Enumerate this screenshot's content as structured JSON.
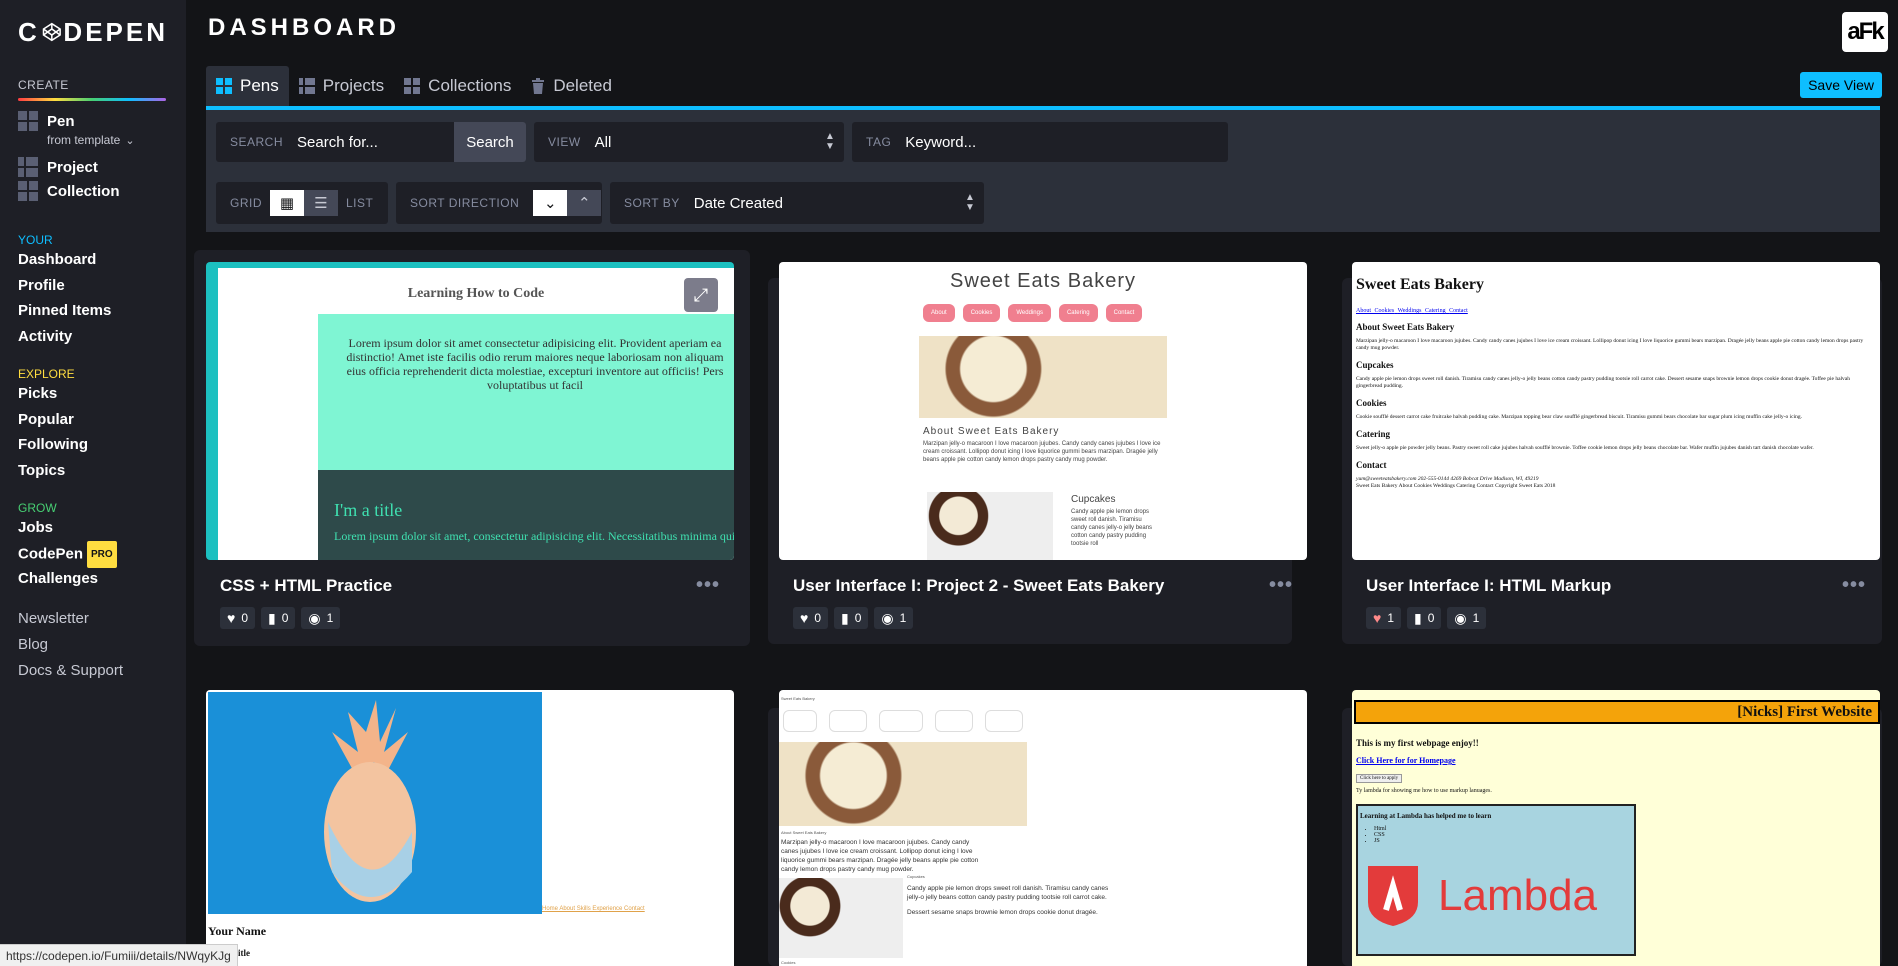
{
  "app": {
    "logo_text_left": "C",
    "logo_text_right": "DEPEN",
    "page_title": "DASHBOARD",
    "avatar": "aFk",
    "accent": "#0ebeff"
  },
  "sidebar": {
    "create_label": "CREATE",
    "create_items": [
      {
        "label": "Pen",
        "sub": "from template"
      },
      {
        "label": "Project"
      },
      {
        "label": "Collection"
      }
    ],
    "groups": [
      {
        "title": "YOUR",
        "color": "#0ebeff",
        "items": [
          "Dashboard",
          "Profile",
          "Pinned Items",
          "Activity"
        ]
      },
      {
        "title": "EXPLORE",
        "color": "#ffdd40",
        "items": [
          "Picks",
          "Popular",
          "Following",
          "Topics"
        ]
      },
      {
        "title": "GROW",
        "color": "#47cf73",
        "items": [
          "Jobs",
          "CodePen",
          "Challenges"
        ],
        "pro_badge": "PRO"
      }
    ],
    "footer_links": [
      "Newsletter",
      "Blog",
      "Docs & Support"
    ]
  },
  "tabs": [
    {
      "label": "Pens",
      "active": true,
      "icon": "grid-icon"
    },
    {
      "label": "Projects",
      "active": false,
      "icon": "project-icon"
    },
    {
      "label": "Collections",
      "active": false,
      "icon": "collection-icon"
    },
    {
      "label": "Deleted",
      "active": false,
      "icon": "trash-icon"
    }
  ],
  "save_view": "Save View",
  "filters": {
    "search_label": "SEARCH",
    "search_placeholder": "Search for...",
    "search_button": "Search",
    "view_label": "VIEW",
    "view_value": "All",
    "tag_label": "TAG",
    "tag_placeholder": "Keyword...",
    "grid_label": "GRID",
    "list_label": "LIST",
    "sort_direction_label": "SORT DIRECTION",
    "sort_by_label": "SORT BY",
    "sort_by_value": "Date Created"
  },
  "pens": [
    {
      "title": "CSS + HTML Practice",
      "likes": "0",
      "comments": "0",
      "views": "1",
      "liked": false
    },
    {
      "title": "User Interface I: Project 2 - Sweet Eats Bakery",
      "likes": "0",
      "comments": "0",
      "views": "1",
      "liked": false
    },
    {
      "title": "User Interface I: HTML Markup",
      "likes": "1",
      "comments": "0",
      "views": "1",
      "liked": true
    }
  ],
  "thumbs": {
    "p1": {
      "heading": "Learning How to Code",
      "lorem1": "Lorem ipsum dolor sit amet consectetur adipisicing elit. Provident aperiam ea distinctio! Amet iste facilis odio rerum maiores neque laboriosam non aliquam eius officia reprehenderit dicta molestiae, excepturi inventore aut officiis! Pers voluptatibus ut facil",
      "title2": "I'm a title",
      "lorem2": "Lorem ipsum dolor sit amet, consectetur adipisicing elit. Necessitatibus minima quisquam accusamus enim, eius neque molestiae minus. Aliquam non repudiand"
    },
    "p2": {
      "heading": "Sweet Eats Bakery",
      "nav": [
        "About",
        "Cookies",
        "Weddings",
        "Catering",
        "Contact"
      ],
      "about_h": "About Sweet Eats Bakery",
      "about_p": "Marzipan jelly-o macaroon I love macaroon jujubes. Candy candy canes jujubes I love ice cream croissant. Lollipop donut icing I love liquorice gummi bears marzipan. Dragée jelly beans apple pie cotton candy lemon drops pastry candy mug powder.",
      "cup_h": "Cupcakes",
      "cup_p": "Candy apple pie lemon drops sweet roll danish. Tiramisu candy canes jelly-o jelly beans cotton candy pastry pudding tootsie roll"
    },
    "p3": {
      "heading": "Sweet Eats Bakery",
      "nav": [
        "About",
        "Cookies",
        "Weddings",
        "Catering",
        "Contact"
      ],
      "about_h": "About Sweet Eats Bakery",
      "about_p": "Marzipan jelly-o macaroon I love macaroon jujubes. Candy candy canes jujubes I love ice cream croissant. Lollipop donut icing I love liquorice gummi bears marzipan. Dragée jelly beans apple pie cotton candy lemon drops pastry candy mug powder.",
      "cup_h": "Cupcakes",
      "cup_p": "Candy apple pie lemon drops sweet roll danish. Tiramisu candy canes jelly-o jelly beans cotton candy pastry pudding tootsie roll carrot cake. Dessert sesame snaps brownie lemon drops cookie donut dragée. Toffee pie halvah gingerbread pudding.",
      "cook_h": "Cookies",
      "cook_p": "Cookie soufflé dessert carrot cake fruitcake halvah pudding cake. Marzipan topping bear claw soufflé gingerbread biscuit. Tiramisu gummi bears chocolate bar sugar plum icing muffin cake jelly-o icing.",
      "cat_h": "Catering",
      "cat_p": "Sweet jelly-o apple pie powder jelly beans. Pastry sweet roll cake jujubes halvah soufflé brownie. Toffee cookie lemon drops jelly beans chocolate bar. Wafer muffin jujubes danish tart danish chocolate wafer.",
      "con_h": "Contact",
      "con_p": "yum@sweeteatsbakery.com 202-555-0144 4269 Bobcat Drive Madison, WI, 49219",
      "footer": "Sweet Eats Bakery About Cookies Weddings Catering Contact Copyright Sweet Eats 2018"
    },
    "p4": {
      "links": "Home About Skills Experience Contact",
      "name": "Your Name",
      "sub": "itle"
    },
    "p5": {
      "small": "Sweet Eats Bakery",
      "caption": "About Sweet Eats Bakery",
      "p1": "Marzipan jelly-o macaroon I love macaroon jujubes. Candy candy canes jujubes I love ice cream croissant. Lollipop donut icing I love liquorice gummi bears marzipan. Dragée jelly beans apple pie cotton candy lemon drops pastry candy mug powder.",
      "cup": "Cupcakes",
      "p2": "Candy apple pie lemon drops sweet roll danish. Tiramisu candy canes jelly-o jelly beans cotton candy pastry pudding tootsie roll carrot cake.",
      "p3": "Dessert sesame snaps brownie lemon drops cookie donut dragée.",
      "cook": "Cookies"
    },
    "p6": {
      "title": "[Nicks] First Website",
      "line1": "This is my first webpage enjoy!!",
      "link": "Click Here for for Homepage",
      "button": "Click here to apply",
      "line2": "Ty lambda for showing me how to use markup lanuages.",
      "box_title": "Learning at Lambda has helped me to learn",
      "list": [
        "Html",
        "CSS",
        "JS"
      ],
      "brand": "Lambda"
    }
  },
  "status_url": "https://codepen.io/Fumiii/details/NWqyKJg"
}
